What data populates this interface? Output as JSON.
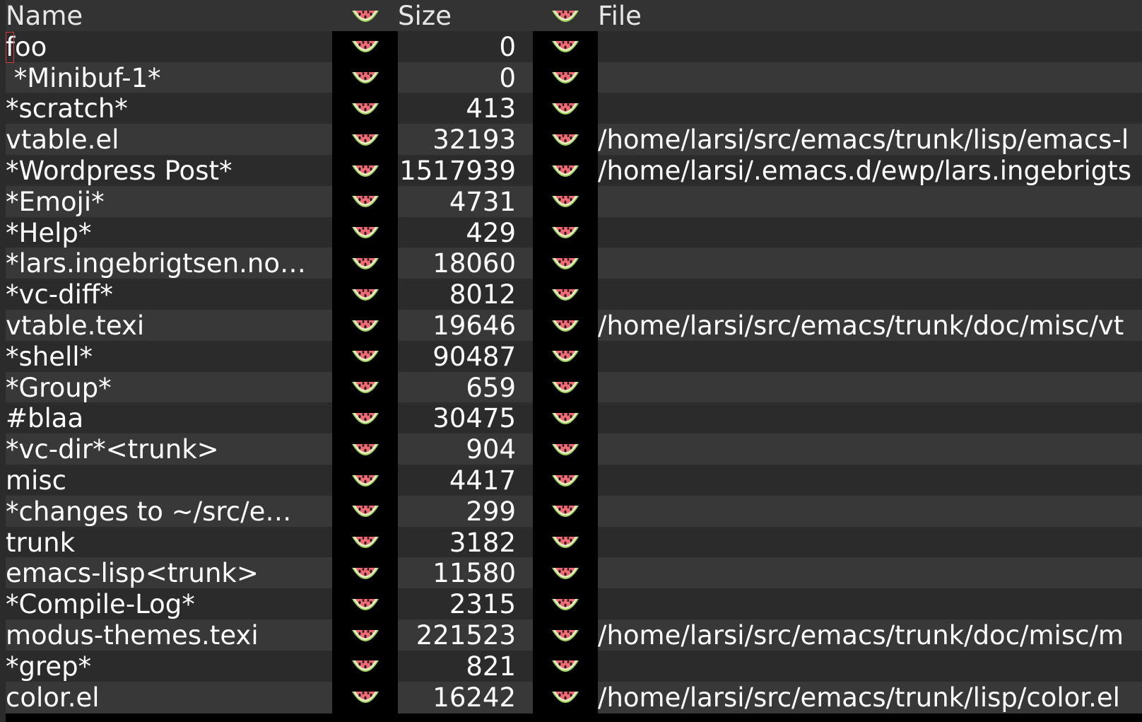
{
  "columns": {
    "name": "Name",
    "size": "Size",
    "file": "File",
    "separator_icon": "watermelon-icon"
  },
  "rows": [
    {
      "name": "foo",
      "size": "0",
      "file": ""
    },
    {
      "name": " *Minibuf-1*",
      "size": "0",
      "file": ""
    },
    {
      "name": "*scratch*",
      "size": "413",
      "file": ""
    },
    {
      "name": "vtable.el",
      "size": "32193",
      "file": "/home/larsi/src/emacs/trunk/lisp/emacs-l"
    },
    {
      "name": "*Wordpress Post*",
      "size": "1517939",
      "file": "/home/larsi/.emacs.d/ewp/lars.ingebrigts"
    },
    {
      "name": "*Emoji*",
      "size": "4731",
      "file": ""
    },
    {
      "name": "*Help*",
      "size": "429",
      "file": ""
    },
    {
      "name": "*lars.ingebrigtsen.no…",
      "size": "18060",
      "file": ""
    },
    {
      "name": "*vc-diff*",
      "size": "8012",
      "file": ""
    },
    {
      "name": "vtable.texi",
      "size": "19646",
      "file": "/home/larsi/src/emacs/trunk/doc/misc/vt"
    },
    {
      "name": "*shell*",
      "size": "90487",
      "file": ""
    },
    {
      "name": "*Group*",
      "size": "659",
      "file": ""
    },
    {
      "name": "#blaa",
      "size": "30475",
      "file": ""
    },
    {
      "name": "*vc-dir*<trunk>",
      "size": "904",
      "file": ""
    },
    {
      "name": "misc",
      "size": "4417",
      "file": ""
    },
    {
      "name": "*changes to ~/src/e…",
      "size": "299",
      "file": ""
    },
    {
      "name": "trunk",
      "size": "3182",
      "file": ""
    },
    {
      "name": "emacs-lisp<trunk>",
      "size": "11580",
      "file": ""
    },
    {
      "name": "*Compile-Log*",
      "size": "2315",
      "file": ""
    },
    {
      "name": "modus-themes.texi",
      "size": "221523",
      "file": "/home/larsi/src/emacs/trunk/doc/misc/m"
    },
    {
      "name": "*grep*",
      "size": "821",
      "file": ""
    },
    {
      "name": "color.el",
      "size": "16242",
      "file": "/home/larsi/src/emacs/trunk/lisp/color.el"
    }
  ]
}
